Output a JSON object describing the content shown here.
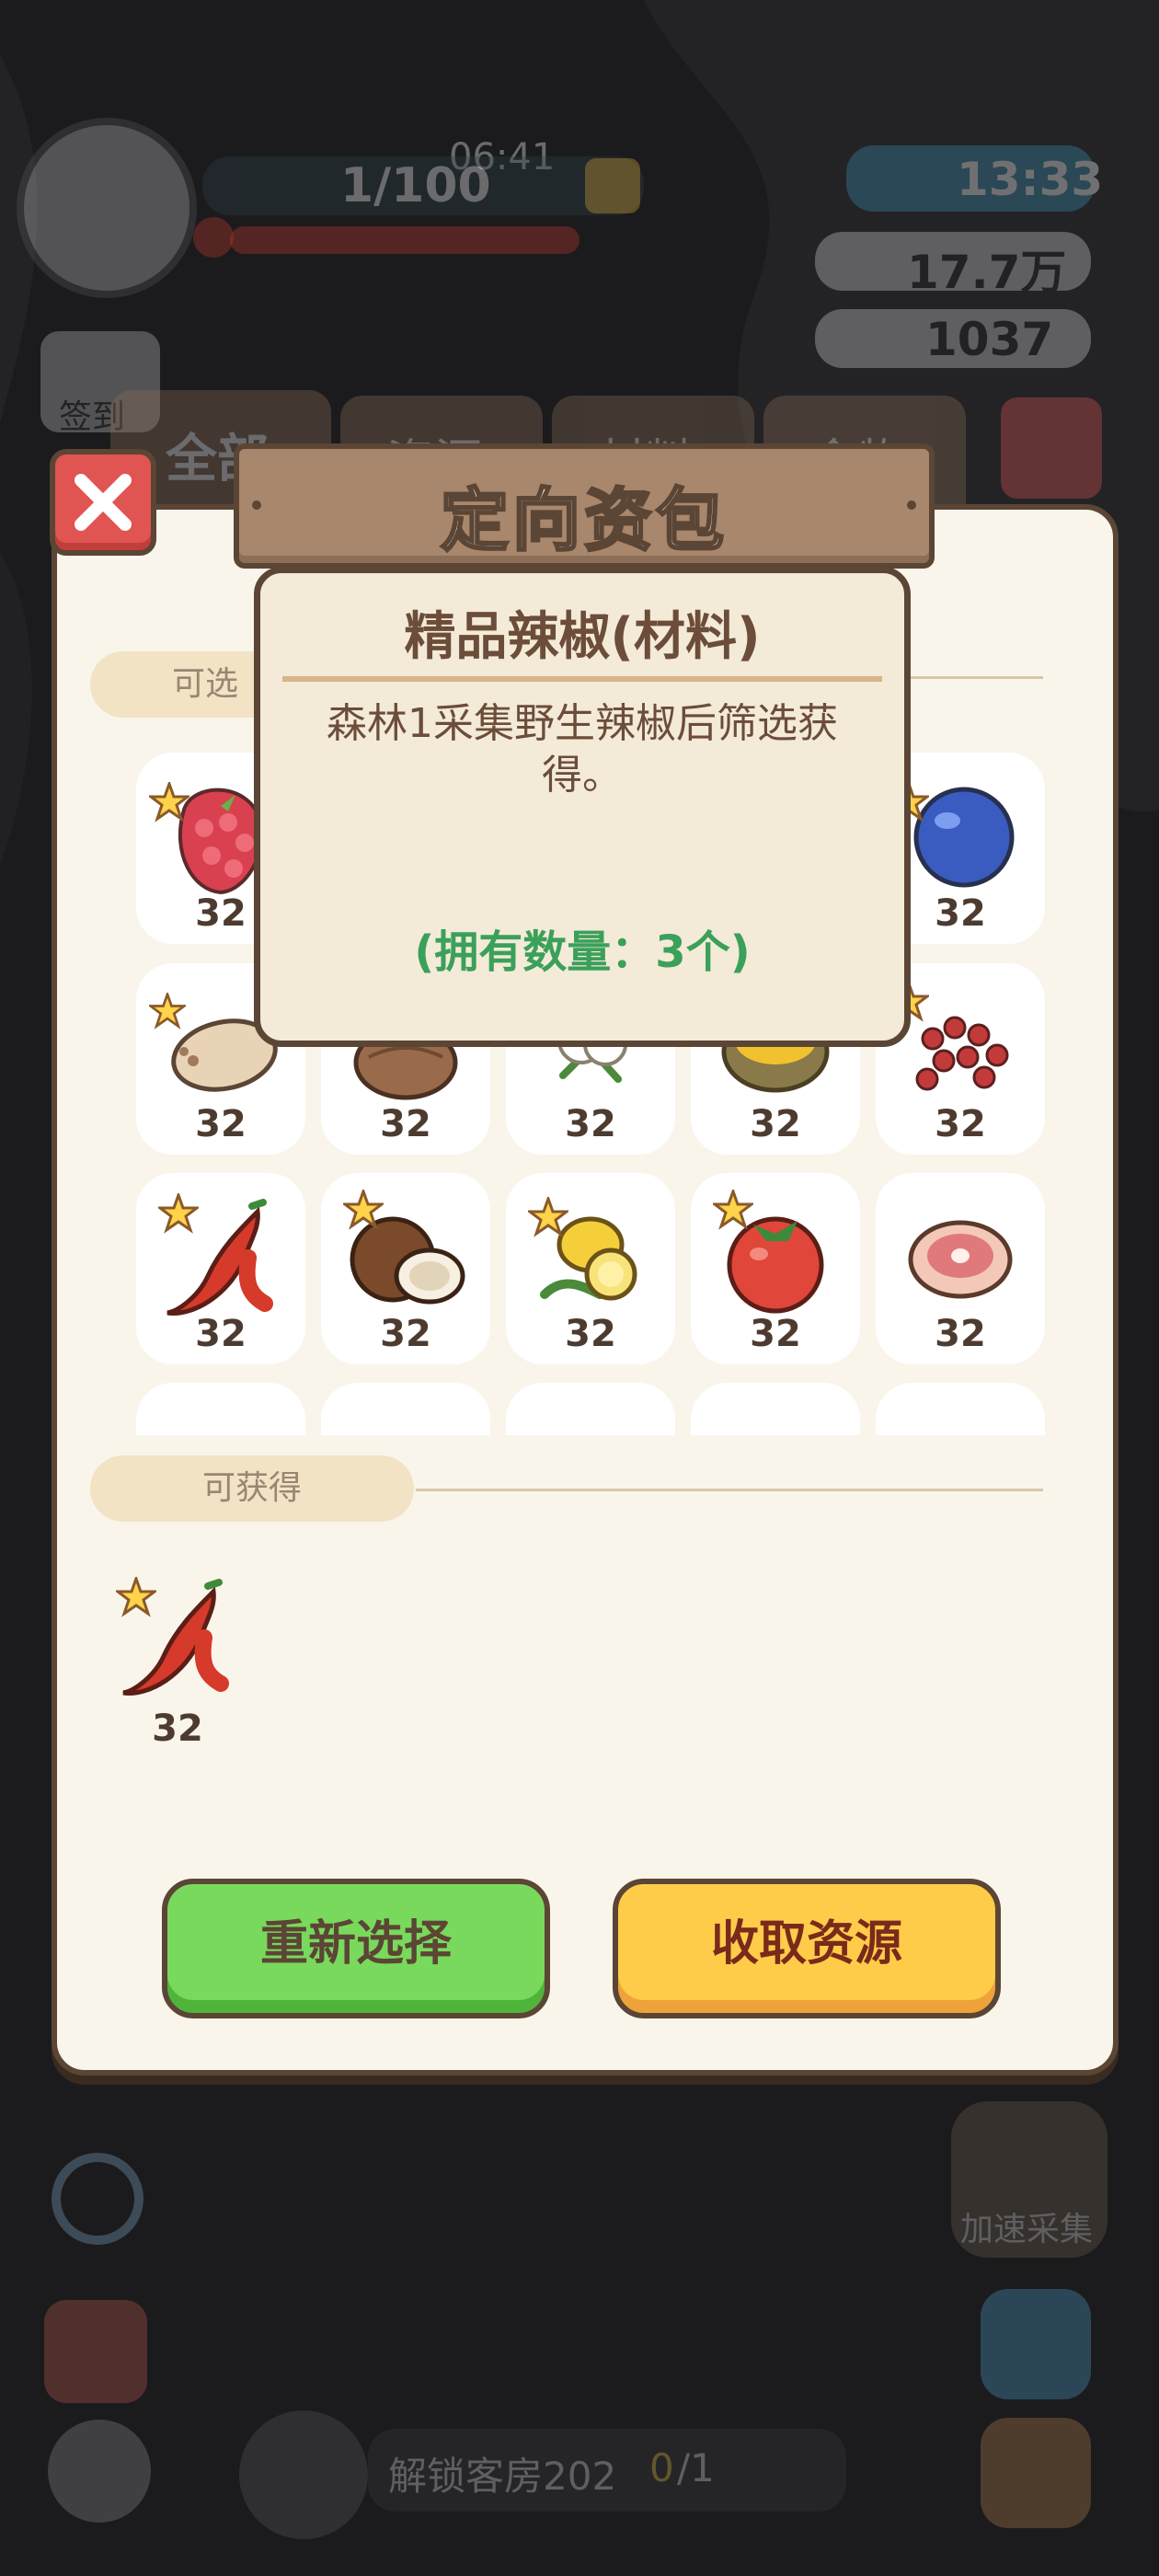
{
  "background": {
    "clock": "06:41",
    "energy": "1/100",
    "timer": "13:33",
    "coins": "17.7万",
    "gems": "1037",
    "tabs": [
      "全部",
      "资源",
      "材料",
      "食物"
    ],
    "task_text": "解锁客房202",
    "task_progress_current": "0",
    "task_progress_total": "/1",
    "side_label_sign": "签到",
    "side_label_speed": "加速采集"
  },
  "dialog": {
    "title": "定向资包",
    "section_selectable": "可选",
    "section_obtainable": "可获得",
    "items": [
      {
        "icon": "raspberry-icon",
        "count": "32",
        "starred": true
      },
      {
        "icon": "hidden",
        "count": "",
        "starred": false
      },
      {
        "icon": "hidden",
        "count": "",
        "starred": false
      },
      {
        "icon": "hidden",
        "count": "",
        "starred": false
      },
      {
        "icon": "blueberry-icon",
        "count": "32",
        "starred": true
      },
      {
        "icon": "lotus-root-icon",
        "count": "32",
        "starred": true
      },
      {
        "icon": "taro-icon",
        "count": "32",
        "starred": false
      },
      {
        "icon": "cotton-icon",
        "count": "32",
        "starred": false
      },
      {
        "icon": "corn-bowl-icon",
        "count": "32",
        "starred": false
      },
      {
        "icon": "red-berries-icon",
        "count": "32",
        "starred": true
      },
      {
        "icon": "chili-pepper-icon",
        "count": "32",
        "starred": true
      },
      {
        "icon": "coconut-icon",
        "count": "32",
        "starred": true
      },
      {
        "icon": "lemon-icon",
        "count": "32",
        "starred": true
      },
      {
        "icon": "tomato-icon",
        "count": "32",
        "starred": true
      },
      {
        "icon": "ham-icon",
        "count": "32",
        "starred": false
      }
    ],
    "obtainable": {
      "icon": "chili-pepper-icon",
      "count": "32"
    },
    "reselect_label": "重新选择",
    "collect_label": "收取资源"
  },
  "tooltip": {
    "name": "精品辣椒(材料)",
    "description": "森林1采集野生辣椒后筛选获得。",
    "owned": "(拥有数量：3个)"
  },
  "colors": {
    "panel_bg": "#f9f5eb",
    "border": "#5b4535",
    "green_button": "#79d95c",
    "yellow_button": "#ffcc4a",
    "close_red": "#e05452",
    "owned_text": "#3aa05a"
  }
}
